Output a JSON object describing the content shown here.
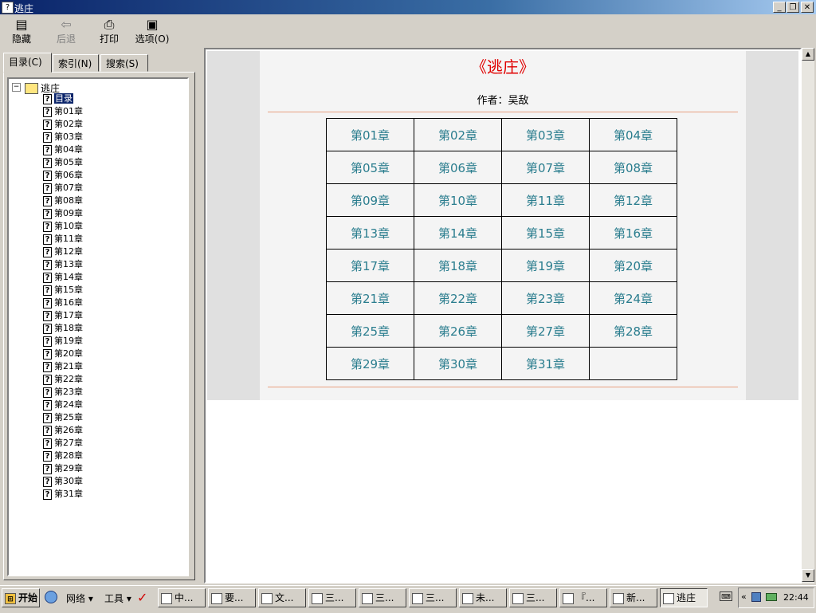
{
  "window": {
    "title": "逃庄",
    "icon": "help-book-icon",
    "controls": [
      "minimize",
      "restore",
      "close"
    ]
  },
  "toolbar": [
    {
      "label": "隐藏",
      "icon": "hide-pane-icon",
      "enabled": true
    },
    {
      "label": "后退",
      "icon": "back-arrow-icon",
      "enabled": false
    },
    {
      "label": "打印",
      "icon": "printer-icon",
      "enabled": true
    },
    {
      "label": "选项(O)",
      "icon": "options-icon",
      "enabled": true
    }
  ],
  "tabs": [
    {
      "label": "目录(C)",
      "active": true
    },
    {
      "label": "索引(N)",
      "active": false
    },
    {
      "label": "搜索(S)",
      "active": false
    }
  ],
  "tree": {
    "root": "逃庄",
    "items": [
      "目录",
      "第01章",
      "第02章",
      "第03章",
      "第04章",
      "第05章",
      "第06章",
      "第07章",
      "第08章",
      "第09章",
      "第10章",
      "第11章",
      "第12章",
      "第13章",
      "第14章",
      "第15章",
      "第16章",
      "第17章",
      "第18章",
      "第19章",
      "第20章",
      "第21章",
      "第22章",
      "第23章",
      "第24章",
      "第25章",
      "第26章",
      "第27章",
      "第28章",
      "第29章",
      "第30章",
      "第31章"
    ],
    "selected": "目录"
  },
  "content": {
    "book_title": "《逃庄》",
    "author": "作者：吴敌",
    "chapters": [
      "第01章",
      "第02章",
      "第03章",
      "第04章",
      "第05章",
      "第06章",
      "第07章",
      "第08章",
      "第09章",
      "第10章",
      "第11章",
      "第12章",
      "第13章",
      "第14章",
      "第15章",
      "第16章",
      "第17章",
      "第18章",
      "第19章",
      "第20章",
      "第21章",
      "第22章",
      "第23章",
      "第24章",
      "第25章",
      "第26章",
      "第27章",
      "第28章",
      "第29章",
      "第30章",
      "第31章"
    ],
    "title_color": "#e00000",
    "link_color": "#2a7d8e"
  },
  "taskbar": {
    "start_label": "开始",
    "quick": [
      {
        "label": "网络",
        "icon": "network-icon"
      },
      {
        "label": "工具",
        "icon": "tools-icon"
      }
    ],
    "tasks": [
      {
        "label": "中...",
        "icon": "app-icon"
      },
      {
        "label": "要...",
        "icon": "ie-icon"
      },
      {
        "label": "文...",
        "icon": "word-icon"
      },
      {
        "label": "三...",
        "icon": "ie-icon"
      },
      {
        "label": "三...",
        "icon": "ie-icon"
      },
      {
        "label": "三...",
        "icon": "ie-icon"
      },
      {
        "label": "未...",
        "icon": "paint-icon"
      },
      {
        "label": "三...",
        "icon": "ie-icon"
      },
      {
        "label": "『...",
        "icon": "ie-icon"
      },
      {
        "label": "新...",
        "icon": "folder-icon"
      },
      {
        "label": "逃庄",
        "icon": "help-book-icon",
        "active": true
      }
    ],
    "clock": "22:44"
  }
}
